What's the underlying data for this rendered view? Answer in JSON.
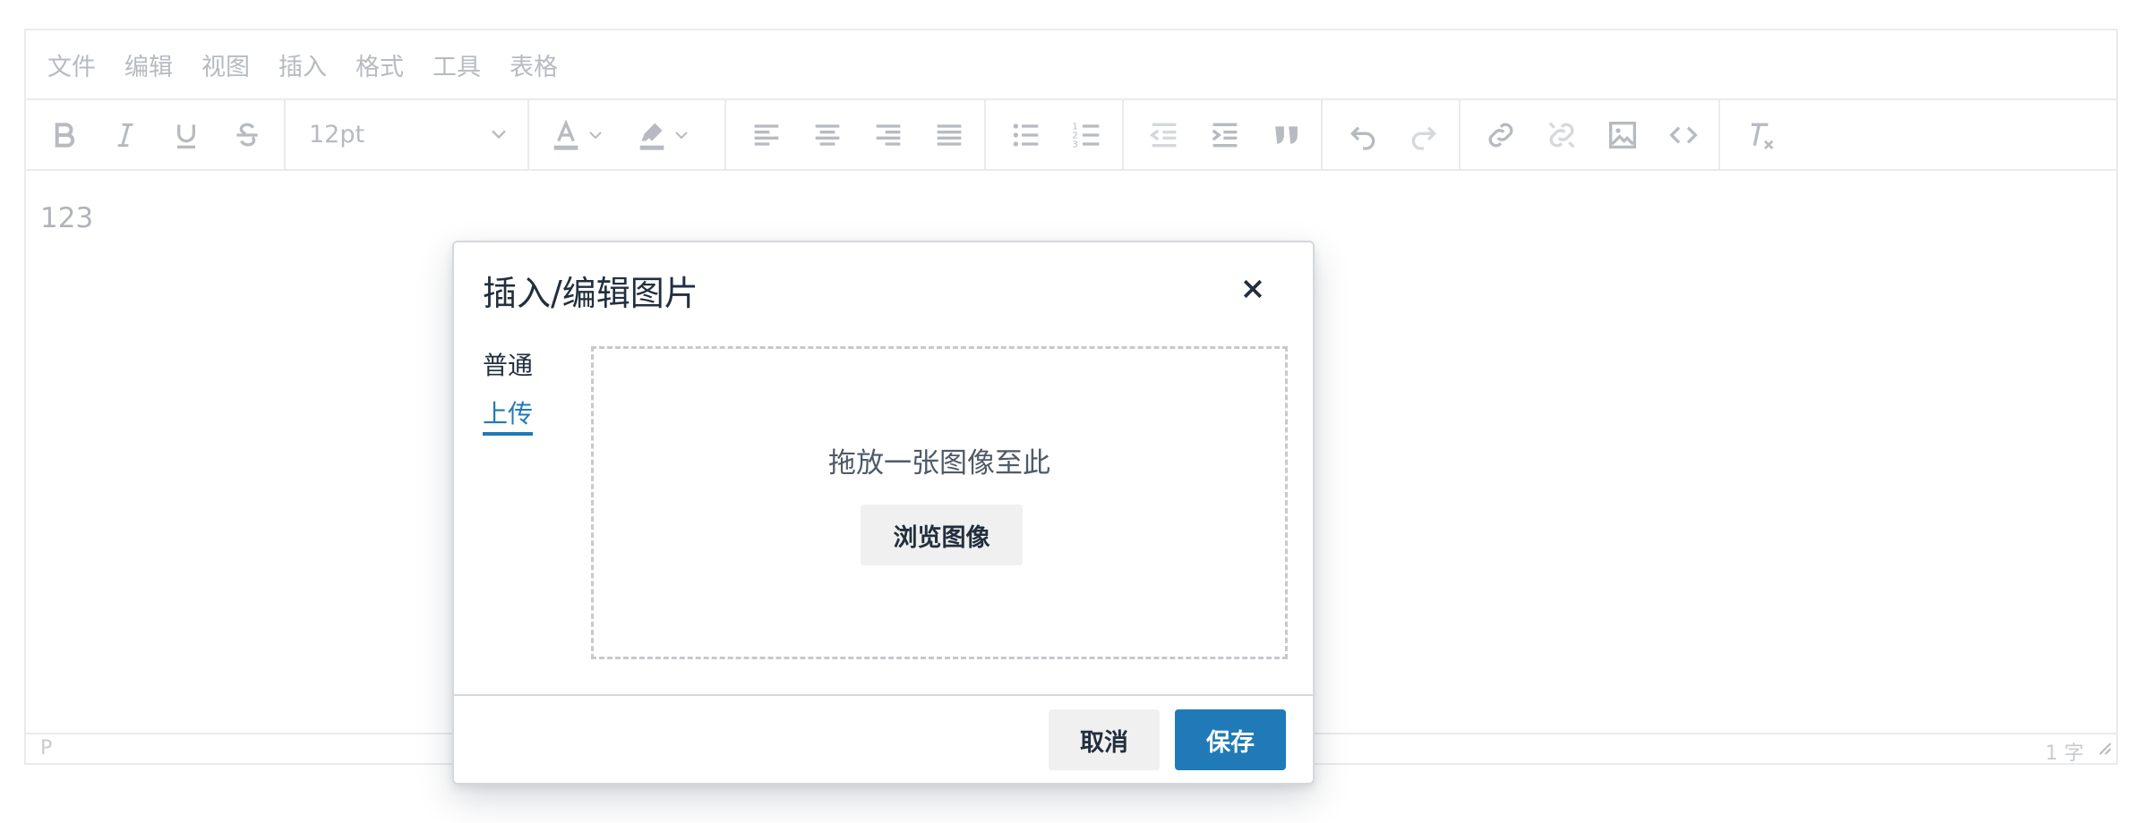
{
  "menubar": {
    "items": [
      "文件",
      "编辑",
      "视图",
      "插入",
      "格式",
      "工具",
      "表格"
    ]
  },
  "toolbar": {
    "font_size": "12pt",
    "icons": [
      "bold-icon",
      "italic-icon",
      "underline-icon",
      "strikethrough-icon",
      "text-color-icon",
      "highlight-color-icon",
      "align-left-icon",
      "align-center-icon",
      "align-right-icon",
      "align-justify-icon",
      "bullet-list-icon",
      "numbered-list-icon",
      "outdent-icon",
      "indent-icon",
      "blockquote-icon",
      "undo-icon",
      "redo-icon",
      "link-icon",
      "unlink-icon",
      "image-icon",
      "code-icon",
      "remove-format-icon"
    ]
  },
  "content": {
    "text": "123"
  },
  "statusbar": {
    "path": "P",
    "word_count": "1 字"
  },
  "dialog": {
    "title": "插入/编辑图片",
    "tabs": {
      "general": "普通",
      "upload": "上传"
    },
    "active_tab": "upload",
    "dropzone_text": "拖放一张图像至此",
    "browse_label": "浏览图像",
    "cancel_label": "取消",
    "save_label": "保存"
  },
  "colors": {
    "accent": "#207ab7",
    "muted_text": "#b7bbc1",
    "border": "#e9ebee",
    "dark_text": "#222f3e"
  }
}
